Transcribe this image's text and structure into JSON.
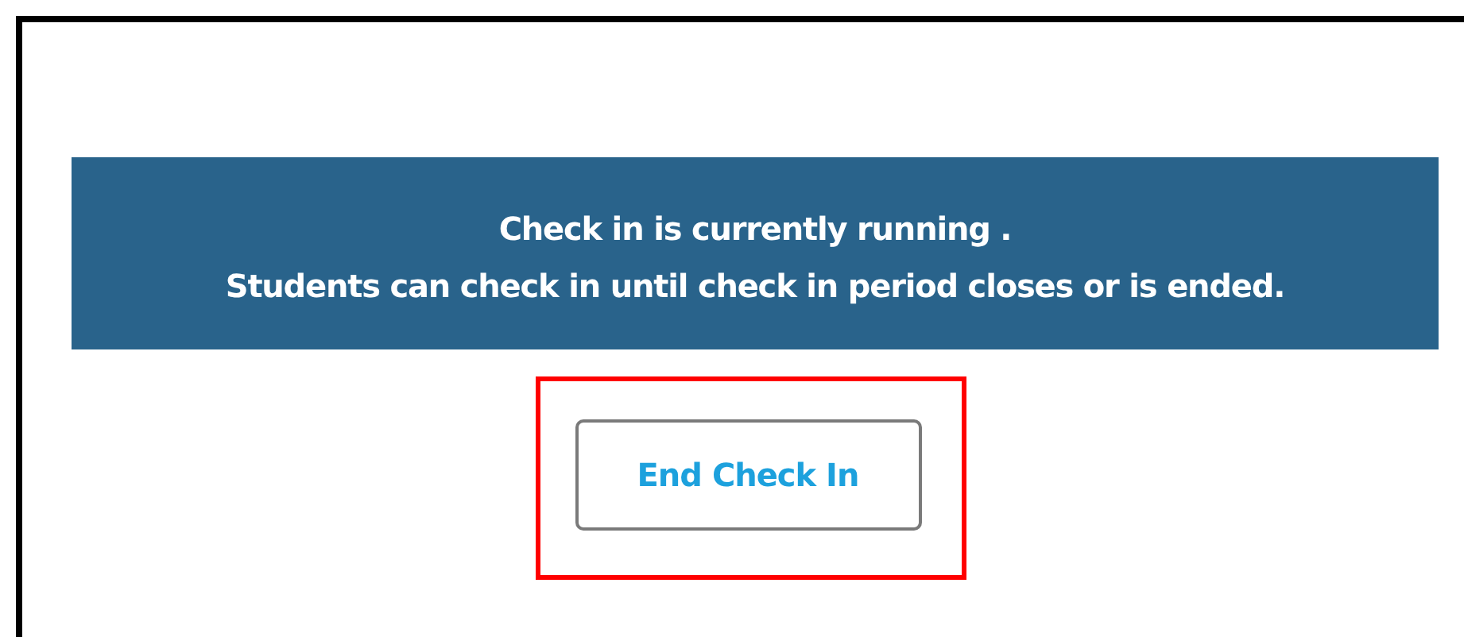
{
  "banner": {
    "lines": [
      "Check in is currently running .",
      "Students can check in until check in period closes or is ended."
    ]
  },
  "button": {
    "label": "End Check In",
    "highlighted": true
  }
}
